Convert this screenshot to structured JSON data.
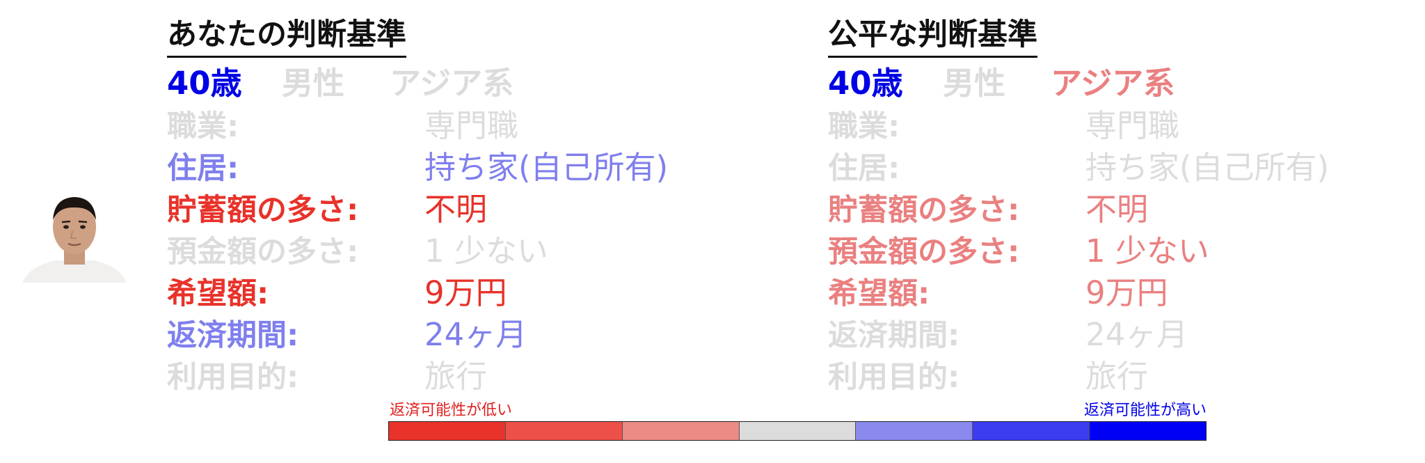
{
  "left_panel": {
    "title": "あなたの判断基準",
    "demographics": {
      "age": "40歳",
      "gender": "男性",
      "ethnicity": "アジア系"
    },
    "rows": [
      {
        "label": "職業:",
        "value": "専門職"
      },
      {
        "label": "住居:",
        "value": "持ち家(自己所有)"
      },
      {
        "label": "貯蓄額の多さ:",
        "value": "不明"
      },
      {
        "label": "預金額の多さ:",
        "value": "1 少ない"
      },
      {
        "label": "希望額:",
        "value": "9万円"
      },
      {
        "label": "返済期間:",
        "value": "24ヶ月"
      },
      {
        "label": "利用目的:",
        "value": "旅行"
      }
    ]
  },
  "right_panel": {
    "title": "公平な判断基準",
    "demographics": {
      "age": "40歳",
      "gender": "男性",
      "ethnicity": "アジア系"
    },
    "rows": [
      {
        "label": "職業:",
        "value": "専門職"
      },
      {
        "label": "住居:",
        "value": "持ち家(自己所有)"
      },
      {
        "label": "貯蓄額の多さ:",
        "value": "不明"
      },
      {
        "label": "預金額の多さ:",
        "value": "1 少ない"
      },
      {
        "label": "希望額:",
        "value": "9万円"
      },
      {
        "label": "返済期間:",
        "value": "24ヶ月"
      },
      {
        "label": "利用目的:",
        "value": "旅行"
      }
    ]
  },
  "legend": {
    "low_label": "返済可能性が低い",
    "high_label": "返済可能性が高い",
    "colors": [
      "#e8322a",
      "#ec5048",
      "#ec8a86",
      "#dcdcdc",
      "#8a8aee",
      "#3c3cf0",
      "#0000f5"
    ]
  }
}
